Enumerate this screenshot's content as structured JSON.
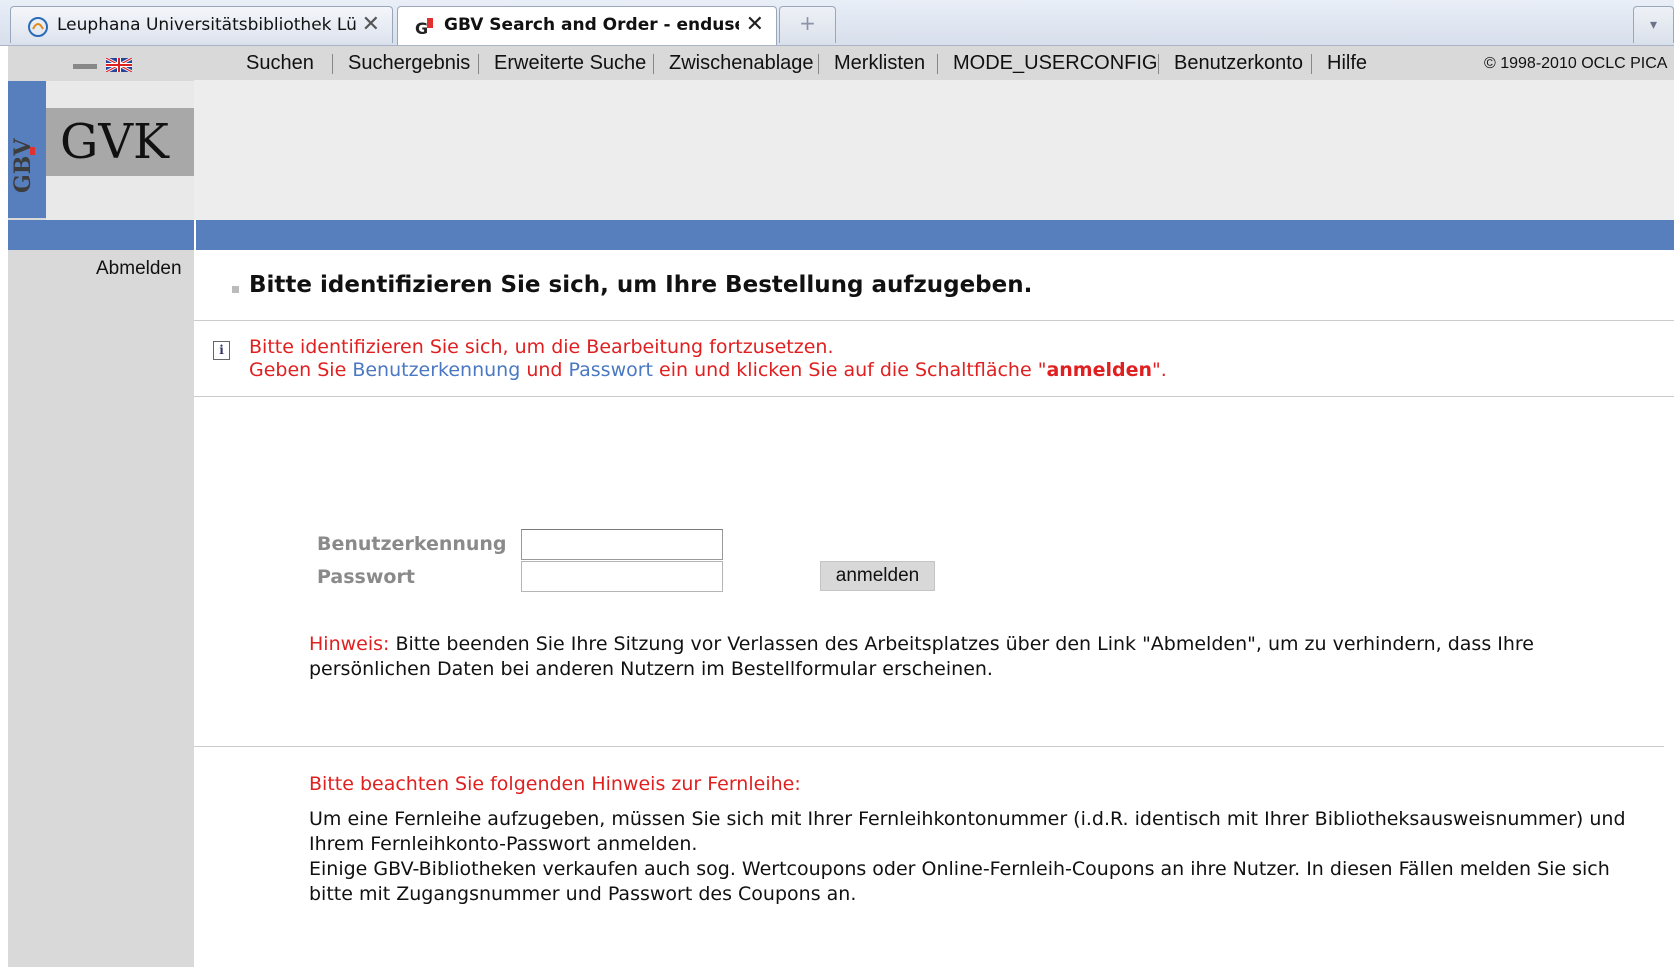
{
  "browser": {
    "tabs": [
      {
        "title": "Leuphana Universitätsbibliothek Lü...",
        "icon": "leuphana-favicon-icon",
        "active": false
      },
      {
        "title": "GBV Search and Order - enduser/...",
        "icon": "gbv-favicon-icon",
        "active": true
      }
    ],
    "new_tab_label": "+",
    "tab_menu_label": "▾",
    "close_glyph": "✕"
  },
  "topnav": {
    "items": [
      "Suchen",
      "Suchergebnis",
      "Erweiterte Suche",
      "Zwischenablage",
      "Merklisten",
      "MODE_USERCONFIG",
      "Benutzerkonto",
      "Hilfe"
    ],
    "copyright": "© 1998-2010 OCLC PICA"
  },
  "logo": {
    "gbv": "GBV",
    "gvk": "GVK"
  },
  "sidebar": {
    "logout_link": "Abmelden"
  },
  "main": {
    "heading": "Bitte identifizieren Sie sich, um Ihre Bestellung aufzugeben.",
    "info": {
      "line1": "Bitte identifizieren Sie sich, um die Bearbeitung fortzusetzen.",
      "line2_prefix": "Geben Sie ",
      "line2_user": "Benutzerkennung",
      "line2_and": " und ",
      "line2_pass": "Passwort",
      "line2_mid": " ein und klicken Sie auf die Schaltfläche \"",
      "line2_button": "anmelden",
      "line2_suffix": "\"."
    },
    "form": {
      "user_label": "Benutzerkennung",
      "user_value": "",
      "pass_label": "Passwort",
      "pass_value": "",
      "submit_label": "anmelden"
    },
    "notice": {
      "label": "Hinweis:",
      "text": " Bitte beenden Sie Ihre Sitzung vor Verlassen des Arbeitsplatzes über den Link \"Abmelden\", um zu verhindern, dass Ihre persönlichen Daten bei anderen Nutzern im Bestellformular erscheinen."
    },
    "ill": {
      "heading": "Bitte beachten Sie folgenden Hinweis zur Fernleihe:",
      "para1": "Um eine Fernleihe aufzugeben, müssen Sie sich mit Ihrer Fernleihkontonummer (i.d.R. identisch mit Ihrer Bibliotheksausweisnummer) und Ihrem Fernleihkonto-Passwort anmelden.",
      "para2": "Einige GBV-Bibliotheken verkaufen auch sog. Wertcoupons oder Online-Fernleih-Coupons an ihre Nutzer. In diesen Fällen melden Sie sich bitte mit Zugangsnummer und Passwort des Coupons an."
    }
  },
  "colors": {
    "accent_blue": "#587fbd",
    "message_red": "#e02020",
    "link_blue": "#4a78c2",
    "sidebar_gray": "#d9d9d9"
  }
}
